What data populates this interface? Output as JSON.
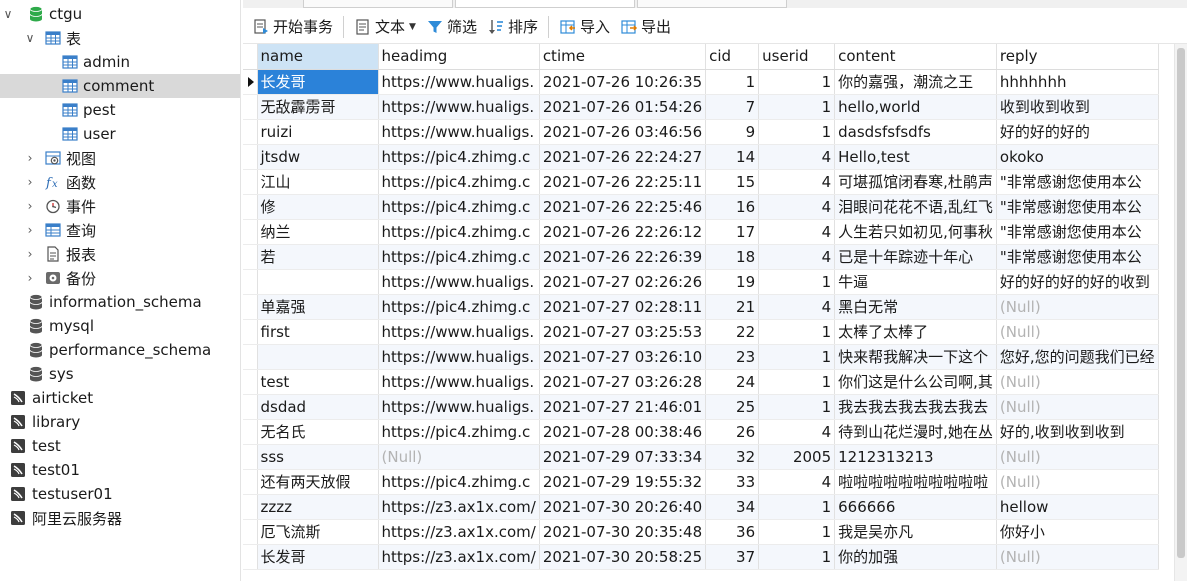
{
  "nav": {
    "items": [
      {
        "label": "ctgu",
        "icon": "database-icon",
        "color": "#2eaa4a"
      },
      {
        "label": "表",
        "icon": "table-icon"
      },
      {
        "label": "admin",
        "icon": "table-icon"
      },
      {
        "label": "comment",
        "icon": "table-icon"
      },
      {
        "label": "pest",
        "icon": "table-icon"
      },
      {
        "label": "user",
        "icon": "table-icon"
      },
      {
        "label": "视图",
        "icon": "view-icon"
      },
      {
        "label": "函数",
        "icon": "function-icon"
      },
      {
        "label": "事件",
        "icon": "event-icon"
      },
      {
        "label": "查询",
        "icon": "query-icon"
      },
      {
        "label": "报表",
        "icon": "report-icon"
      },
      {
        "label": "备份",
        "icon": "backup-icon"
      },
      {
        "label": "information_schema",
        "icon": "database-icon"
      },
      {
        "label": "mysql",
        "icon": "database-icon"
      },
      {
        "label": "performance_schema",
        "icon": "database-icon"
      },
      {
        "label": "sys",
        "icon": "database-icon"
      },
      {
        "label": "airticket",
        "icon": "connection-icon"
      },
      {
        "label": "library",
        "icon": "connection-icon"
      },
      {
        "label": "test",
        "icon": "connection-icon"
      },
      {
        "label": "test01",
        "icon": "connection-icon"
      },
      {
        "label": "testuser01",
        "icon": "connection-icon"
      },
      {
        "label": "阿里云服务器",
        "icon": "connection-icon"
      }
    ],
    "selected": "comment"
  },
  "toolbar": {
    "begin_transaction": "开始事务",
    "text": "文本",
    "filter": "筛选",
    "sort": "排序",
    "import": "导入",
    "export": "导出"
  },
  "grid": {
    "columns": [
      "name",
      "headimg",
      "ctime",
      "cid",
      "userid",
      "content",
      "reply"
    ],
    "rows": [
      {
        "name": "长发哥",
        "headimg": "https://www.hualigs.",
        "ctime": "2021-07-26 10:26:35",
        "cid": "1",
        "userid": "1",
        "content": "你的嘉强，潮流之王",
        "reply": "hhhhhhh"
      },
      {
        "name": "无敌霹雳哥",
        "headimg": "https://www.hualigs.",
        "ctime": "2021-07-26 01:54:26",
        "cid": "7",
        "userid": "1",
        "content": "hello,world",
        "reply": "收到收到收到"
      },
      {
        "name": "ruizi",
        "headimg": "https://www.hualigs.",
        "ctime": "2021-07-26 03:46:56",
        "cid": "9",
        "userid": "1",
        "content": "dasdsfsfsdfs",
        "reply": "好的好的好的"
      },
      {
        "name": "jtsdw",
        "headimg": "https://pic4.zhimg.c",
        "ctime": "2021-07-26 22:24:27",
        "cid": "14",
        "userid": "4",
        "content": "Hello,test",
        "reply": "okoko"
      },
      {
        "name": "江山",
        "headimg": "https://pic4.zhimg.c",
        "ctime": "2021-07-26 22:25:11",
        "cid": "15",
        "userid": "4",
        "content": "可堪孤馆闭春寒,杜鹃声",
        "reply": "\"非常感谢您使用本公"
      },
      {
        "name": "修",
        "headimg": "https://pic4.zhimg.c",
        "ctime": "2021-07-26 22:25:46",
        "cid": "16",
        "userid": "4",
        "content": "泪眼问花花不语,乱红飞",
        "reply": "\"非常感谢您使用本公"
      },
      {
        "name": "纳兰",
        "headimg": "https://pic4.zhimg.c",
        "ctime": "2021-07-26 22:26:12",
        "cid": "17",
        "userid": "4",
        "content": "人生若只如初见,何事秋",
        "reply": "\"非常感谢您使用本公"
      },
      {
        "name": "若",
        "headimg": "https://pic4.zhimg.c",
        "ctime": "2021-07-26 22:26:39",
        "cid": "18",
        "userid": "4",
        "content": "已是十年踪迹十年心",
        "reply": "\"非常感谢您使用本公"
      },
      {
        "name": "",
        "headimg": "https://www.hualigs.",
        "ctime": "2021-07-27 02:26:26",
        "cid": "19",
        "userid": "1",
        "content": "牛逼",
        "reply": "好的好的好的好的收到"
      },
      {
        "name": "单嘉强",
        "headimg": "https://pic4.zhimg.c",
        "ctime": "2021-07-27 02:28:11",
        "cid": "21",
        "userid": "4",
        "content": "黑白无常",
        "reply": "(Null)"
      },
      {
        "name": "first",
        "headimg": "https://www.hualigs.",
        "ctime": "2021-07-27 03:25:53",
        "cid": "22",
        "userid": "1",
        "content": "太棒了太棒了",
        "reply": "(Null)"
      },
      {
        "name": "",
        "headimg": "https://www.hualigs.",
        "ctime": "2021-07-27 03:26:10",
        "cid": "23",
        "userid": "1",
        "content": "快来帮我解决一下这个",
        "reply": "您好,您的问题我们已经"
      },
      {
        "name": "test",
        "headimg": "https://www.hualigs.",
        "ctime": "2021-07-27 03:26:28",
        "cid": "24",
        "userid": "1",
        "content": "你们这是什么公司啊,其",
        "reply": "(Null)"
      },
      {
        "name": "dsdad",
        "headimg": "https://www.hualigs.",
        "ctime": "2021-07-27 21:46:01",
        "cid": "25",
        "userid": "1",
        "content": "我去我去我去我去我去",
        "reply": "(Null)"
      },
      {
        "name": "无名氏",
        "headimg": "https://pic4.zhimg.c",
        "ctime": "2021-07-28 00:38:46",
        "cid": "26",
        "userid": "4",
        "content": "待到山花烂漫时,她在丛",
        "reply": "好的,收到收到收到"
      },
      {
        "name": "sss",
        "headimg": "(Null)",
        "ctime": "2021-07-29 07:33:34",
        "cid": "32",
        "userid": "2005",
        "content": "1212313213",
        "reply": "(Null)"
      },
      {
        "name": "还有两天放假",
        "headimg": "https://pic4.zhimg.c",
        "ctime": "2021-07-29 19:55:32",
        "cid": "33",
        "userid": "4",
        "content": "啦啦啦啦啦啦啦啦啦啦",
        "reply": "(Null)"
      },
      {
        "name": "zzzz",
        "headimg": "https://z3.ax1x.com/",
        "ctime": "2021-07-30 20:26:40",
        "cid": "34",
        "userid": "1",
        "content": "666666",
        "reply": "hellow"
      },
      {
        "name": "厄飞流斯",
        "headimg": "https://z3.ax1x.com/",
        "ctime": "2021-07-30 20:35:48",
        "cid": "36",
        "userid": "1",
        "content": "我是吴亦凡",
        "reply": "你好小"
      },
      {
        "name": "长发哥",
        "headimg": "https://z3.ax1x.com/",
        "ctime": "2021-07-30 20:58:25",
        "cid": "37",
        "userid": "1",
        "content": "你的加强",
        "reply": "(Null)"
      }
    ]
  },
  "colors": {
    "selection": "#2b82d9",
    "null_text": "#b3b3b3",
    "alt_row": "#f4f7fc",
    "nav_selected": "#d9d9d9"
  }
}
